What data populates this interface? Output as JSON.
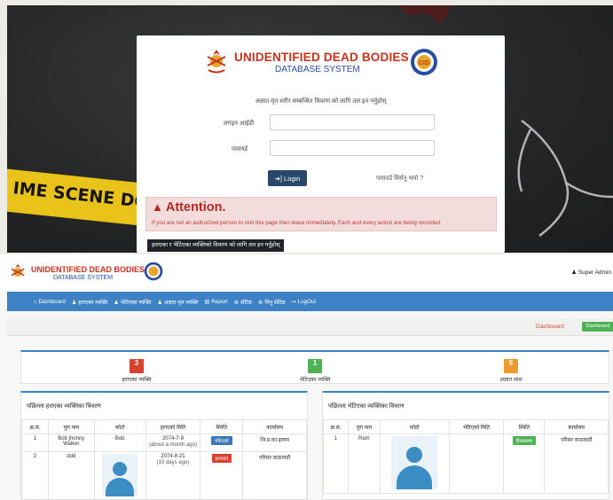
{
  "login": {
    "title": "UNIDENTIFIED DEAD BODIES",
    "subtitle": "DATABASE SYSTEM",
    "cid_badge": "CID",
    "intro": "अज्ञात मृत शरीर सम्बन्धित विवरण को लागि तल इन गर्नुहोस्",
    "username_label": "लगइन आईडी",
    "password_label": "पासवर्ड",
    "login_button": "Login",
    "forgot_link": "पासवर्ड बिर्सनु भयो ?",
    "alert_title": "Attention.",
    "alert_text": "If you are not an authorized person to visit this page then leave immediately. Each and every action are being recorded.",
    "public_search_button": "हराएका र भेटिएका व्यक्तिको विवरण को लागि तल इन गर्नुहोस्",
    "crime_tape_text": "IME SCENE    DO NO"
  },
  "dashboard": {
    "header": {
      "title": "UNIDENTIFIED DEAD BODIES",
      "subtitle": "DATABASE SYSTEM",
      "user": "Super Admin"
    },
    "nav": [
      {
        "icon": "home-icon",
        "glyph": "⌂",
        "label": "Dashboard"
      },
      {
        "icon": "users-icon",
        "glyph": "♟",
        "label": "हराएका व्यक्ति"
      },
      {
        "icon": "users-icon",
        "glyph": "♟",
        "label": "भेटिएका व्यक्ति"
      },
      {
        "icon": "users-icon",
        "glyph": "♟",
        "label": "अज्ञात मृत व्यक्ति"
      },
      {
        "icon": "report-icon",
        "glyph": "▤",
        "label": "Report"
      },
      {
        "icon": "settings-icon",
        "glyph": "⚙",
        "label": "सेटिङ"
      },
      {
        "icon": "settings-icon",
        "glyph": "⚙",
        "label": "मिनु सेटिङ"
      },
      {
        "icon": "logout-icon",
        "glyph": "↦",
        "label": "LogOut"
      }
    ],
    "breadcrumb": {
      "link": "Dashboard",
      "active": "Dashboard"
    },
    "stats": [
      {
        "count": "3",
        "label": "हराएका व्यक्ति",
        "color": "#d9412f"
      },
      {
        "count": "1",
        "label": "भेटिएका व्यक्ति",
        "color": "#4eb255"
      },
      {
        "count": "6",
        "label": "अज्ञात लाश",
        "color": "#ee9a2a"
      }
    ],
    "missing_panel": {
      "title": "पछिल्ला हराएका व्यक्तिका विवरण",
      "columns": [
        "क्र.सं.",
        "पुरा नाम",
        "फोटो",
        "हराएको मिति",
        "स्थिति",
        "कार्यालय"
      ],
      "rows": [
        {
          "sn": "1",
          "name": "Bob jhonny Walker",
          "photo": "Bob",
          "date": "2074-7-9",
          "ago": "(about a month ago)",
          "status": "भेटिएको",
          "status_color": "#3b77b8",
          "office": "जि.प्र.का.इलाम"
        },
        {
          "sn": "2",
          "name": "ddd",
          "photo": "",
          "date": "2074-8-21",
          "ago": "(10 days ago)",
          "status": "हराएको",
          "status_color": "#d9412f",
          "office": "परिसर काठमाडौं"
        }
      ]
    },
    "found_panel": {
      "title": "पछिल्ला भेटिएका व्यक्तिका विवरण",
      "columns": [
        "क्र.सं.",
        "पुरा नाम",
        "फोटो",
        "भेटिएको मिति",
        "स्थिति",
        "कार्यालय"
      ],
      "rows": [
        {
          "sn": "1",
          "name": "Ram",
          "date": "",
          "status": "हिरासतमा",
          "status_color": "#4eb255",
          "office": "परिसर काठमाडौं"
        }
      ]
    }
  }
}
